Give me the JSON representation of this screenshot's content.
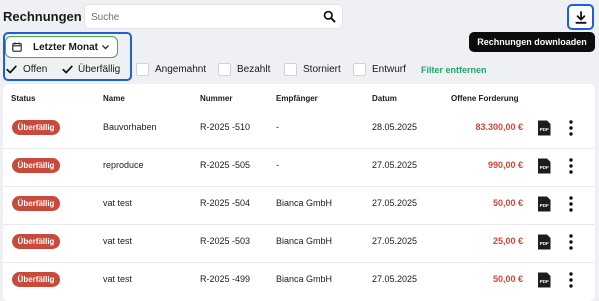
{
  "header": {
    "title": "Rechnungen",
    "search_placeholder": "Suche",
    "download_tooltip": "Rechnungen downloaden"
  },
  "filters": {
    "date_range": "Letzter Monat",
    "status_options": [
      {
        "label": "Offen",
        "checked": true
      },
      {
        "label": "Überfällig",
        "checked": true
      },
      {
        "label": "Angemahnt",
        "checked": false
      },
      {
        "label": "Bezahlt",
        "checked": false
      },
      {
        "label": "Storniert",
        "checked": false
      },
      {
        "label": "Entwurf",
        "checked": false
      }
    ],
    "clear_label": "Filter entfernen"
  },
  "table": {
    "columns": [
      "Status",
      "Name",
      "Nummer",
      "Empfänger",
      "Datum",
      "Offene Forderung"
    ],
    "rows": [
      {
        "status": "Überfällig",
        "name": "Bauvorhaben",
        "number": "R-2025 -510",
        "recipient": "-",
        "date": "28.05.2025",
        "amount": "83.300,00 €"
      },
      {
        "status": "Überfällig",
        "name": "reproduce",
        "number": "R-2025 -505",
        "recipient": "-",
        "date": "27.05.2025",
        "amount": "990,00 €"
      },
      {
        "status": "Überfällig",
        "name": "vat test",
        "number": "R-2025 -504",
        "recipient": "Bianca GmbH",
        "date": "27.05.2025",
        "amount": "50,00 €"
      },
      {
        "status": "Überfällig",
        "name": "vat test",
        "number": "R-2025 -503",
        "recipient": "Bianca GmbH",
        "date": "27.05.2025",
        "amount": "25,00 €"
      },
      {
        "status": "Überfällig",
        "name": "vat test",
        "number": "R-2025 -499",
        "recipient": "Bianca GmbH",
        "date": "27.05.2025",
        "amount": "50,00 €"
      }
    ],
    "row_icons": {
      "document": "pdf-icon",
      "actions": "more-vertical-icon"
    }
  },
  "colors": {
    "overdue": "#c9493b",
    "accent_blue": "#1e5fd6",
    "clear_filter_green": "#27a36b",
    "date_pill_border": "#4aa64a"
  }
}
